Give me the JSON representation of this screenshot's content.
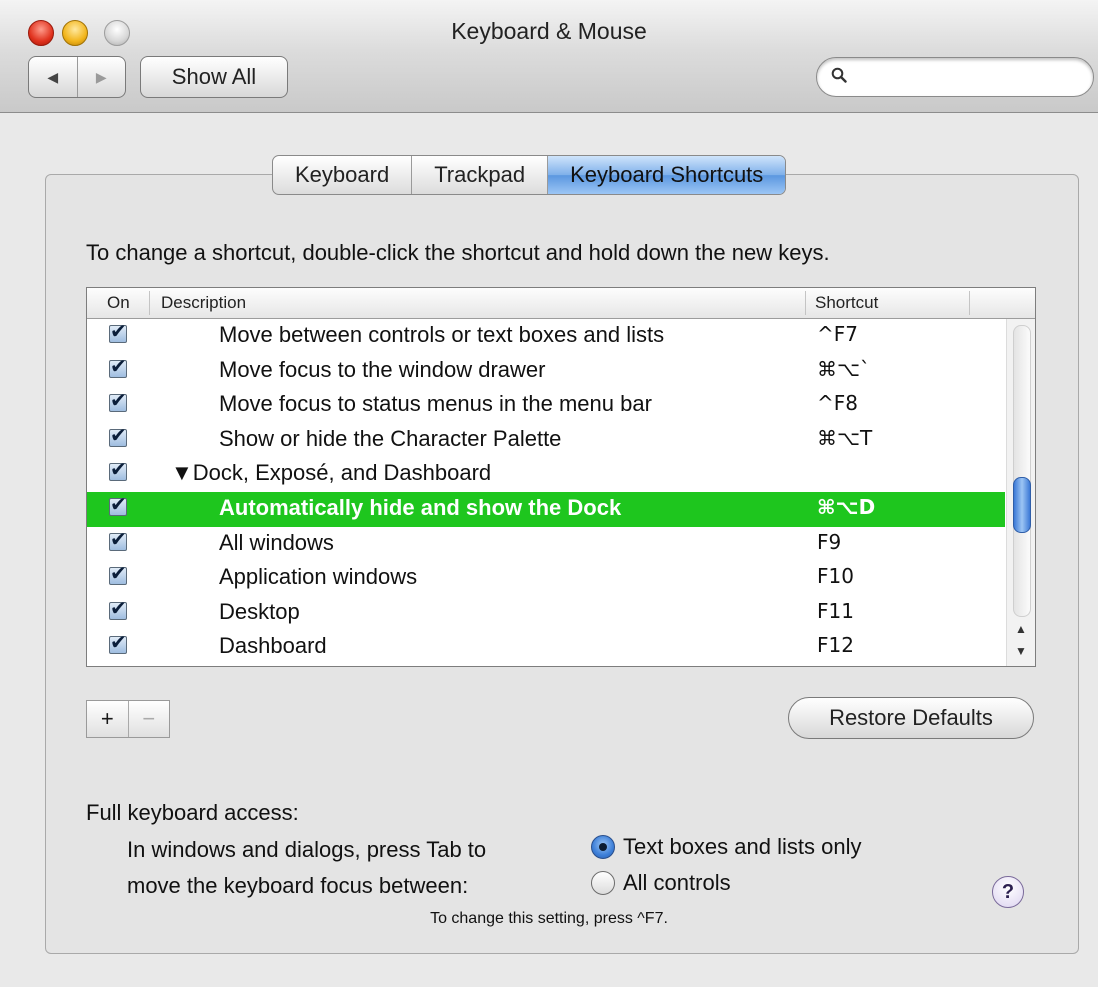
{
  "window": {
    "title": "Keyboard & Mouse"
  },
  "toolbar": {
    "back_icon": "◀",
    "forward_icon": "▶",
    "show_all_label": "Show All",
    "search_placeholder": ""
  },
  "tabs": [
    {
      "label": "Keyboard",
      "active": false
    },
    {
      "label": "Trackpad",
      "active": false
    },
    {
      "label": "Keyboard Shortcuts",
      "active": true
    }
  ],
  "instruction": "To change a shortcut, double-click the shortcut and hold down the new keys.",
  "table": {
    "headers": {
      "on": "On",
      "description": "Description",
      "shortcut": "Shortcut"
    },
    "rows": [
      {
        "checked": true,
        "description": "Move between controls or text boxes and lists",
        "shortcut": "^F7",
        "indent": 2,
        "selected": false
      },
      {
        "checked": true,
        "description": "Move focus to the window drawer",
        "shortcut": "⌘⌥`",
        "indent": 2,
        "selected": false
      },
      {
        "checked": true,
        "description": "Move focus to status menus in the menu bar",
        "shortcut": "^F8",
        "indent": 2,
        "selected": false
      },
      {
        "checked": true,
        "description": "Show or hide the Character Palette",
        "shortcut": "⌘⌥T",
        "indent": 2,
        "selected": false
      },
      {
        "checked": true,
        "description": "▼Dock, Exposé, and Dashboard",
        "shortcut": "",
        "indent": 1,
        "selected": false
      },
      {
        "checked": true,
        "description": "Automatically hide and show the Dock",
        "shortcut": "⌘⌥D",
        "indent": 2,
        "selected": true
      },
      {
        "checked": true,
        "description": "All windows",
        "shortcut": "F9",
        "indent": 2,
        "selected": false
      },
      {
        "checked": true,
        "description": "Application windows",
        "shortcut": "F10",
        "indent": 2,
        "selected": false
      },
      {
        "checked": true,
        "description": "Desktop",
        "shortcut": "F11",
        "indent": 2,
        "selected": false
      },
      {
        "checked": true,
        "description": "Dashboard",
        "shortcut": "F12",
        "indent": 2,
        "selected": false
      }
    ]
  },
  "buttons": {
    "add": "+",
    "remove": "−",
    "restore_defaults": "Restore Defaults"
  },
  "full_keyboard_access": {
    "label": "Full keyboard access:",
    "line1": "In windows and dialogs, press Tab to",
    "line2": "move the keyboard focus between:",
    "options": [
      {
        "label": "Text boxes and lists only",
        "selected": true
      },
      {
        "label": "All controls",
        "selected": false
      }
    ],
    "hint": "To change this setting, press ^F7."
  },
  "help_label": "?",
  "colors": {
    "selection": "#1ec61e",
    "tab_active": "#7fb0ea"
  }
}
